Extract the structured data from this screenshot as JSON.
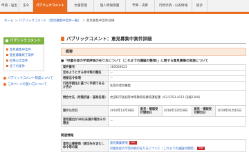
{
  "nav": {
    "tabs": [
      {
        "label": "申請・届出"
      },
      {
        "label": "法令"
      },
      {
        "label": "パブリックコメント"
      },
      {
        "label": "文書管理"
      },
      {
        "label": "個人情報保護"
      },
      {
        "label": "予算・決算"
      },
      {
        "label": "行政手続・公表情報"
      },
      {
        "label": "統計"
      }
    ]
  },
  "breadcrumb": {
    "home": "ホーム",
    "list": "パブリックコメント（意見募集中案件一覧）",
    "current": "意見募集中案件詳細"
  },
  "sidebar": {
    "heading": "パブリックコメント",
    "items": [
      {
        "label": "意見募集中案件"
      },
      {
        "label": "意見募集終了案件"
      },
      {
        "label": "結果公示案件"
      },
      {
        "label": "全ての案件"
      }
    ],
    "links": [
      {
        "label": "パブリックコメント制度について"
      },
      {
        "label": "このページの使い方について"
      }
    ]
  },
  "main": {
    "title": "パブリックコメント：意見募集中案件詳細",
    "section": "概要",
    "case_title": "■「児童生徒の学習評価の在り方について（これまでの議論の整理）」に関する意見募集の実施について",
    "rows": [
      {
        "label": "案件番号",
        "value": "185000023"
      },
      {
        "label": "定めようとする命令等の題名",
        "value": "－"
      },
      {
        "label": "根拠法令条項",
        "value": "－"
      },
      {
        "label": "行政手続法に基づく手続であるか否か",
        "value": "任意の意見募集"
      },
      {
        "label": "問合せ先（所管府省・部局名等）",
        "value": "文部科学省初等中等教育局教育課程課（03-5253-4111 内線2369）"
      }
    ],
    "dates": {
      "announce_label": "案の公示日",
      "announce": "2018年12月18日",
      "start_label": "意見・情報受付開始日",
      "start": "2018年12月18日",
      "end_label": "意見・情報受付締切日",
      "end": "2019年01月16日"
    },
    "reason_label": "意見提出が30日未満の場合その理由",
    "reason": "－",
    "related_head": "関連情報",
    "related_label": "意見公募要領（提出先を含む）、命令等の案",
    "related_links": [
      {
        "label": "意見募集要項",
        "badge": "PDF"
      },
      {
        "label": "児童生徒の学習評価の在り方について（これまでの議論の整理）",
        "badge": "PDF"
      }
    ]
  },
  "colors": {
    "accent": "#ea6b1e",
    "sidebar_head": "#7db440",
    "link": "#2a67c7"
  }
}
